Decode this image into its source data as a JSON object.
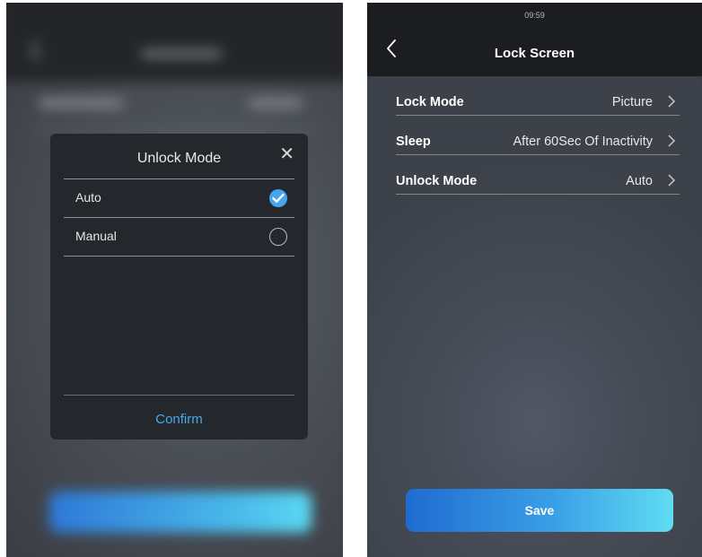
{
  "unlock_modal": {
    "title": "Unlock Mode",
    "options": [
      {
        "label": "Auto",
        "selected": true
      },
      {
        "label": "Manual",
        "selected": false
      }
    ],
    "confirm_label": "Confirm",
    "accent_color": "#43a6ee"
  },
  "lock_screen": {
    "status_time": "09:59",
    "title": "Lock Screen",
    "settings": [
      {
        "label": "Lock Mode",
        "value": "Picture"
      },
      {
        "label": "Sleep",
        "value": "After 60Sec Of Inactivity"
      },
      {
        "label": "Unlock Mode",
        "value": "Auto"
      }
    ],
    "save_label": "Save"
  },
  "icons": [
    "back-arrow-icon",
    "close-icon",
    "check-icon",
    "chevron-right-icon"
  ]
}
